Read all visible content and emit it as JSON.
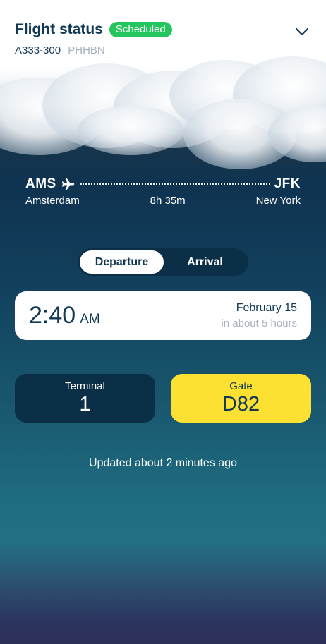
{
  "header": {
    "title": "Flight status",
    "status_badge": "Scheduled",
    "aircraft": "A333-300",
    "registration": "PHHBN"
  },
  "route": {
    "origin_code": "AMS",
    "origin_city": "Amsterdam",
    "destination_code": "JFK",
    "destination_city": "New York",
    "duration": "8h 35m"
  },
  "toggle": {
    "departure_label": "Departure",
    "arrival_label": "Arrival",
    "selected": "Departure"
  },
  "time_card": {
    "time": "2:40",
    "ampm": "AM",
    "date": "February 15",
    "relative": "in about 5 hours"
  },
  "terminal": {
    "label": "Terminal",
    "value": "1"
  },
  "gate": {
    "label": "Gate",
    "value": "D82"
  },
  "footer": {
    "updated": "Updated about 2 minutes ago"
  },
  "colors": {
    "accent_navy": "#113954",
    "badge_green": "#22c55e",
    "gate_yellow": "#fde132",
    "card_dark": "#0c2f48"
  },
  "icons": [
    "chevron-down-icon",
    "plane-icon"
  ]
}
